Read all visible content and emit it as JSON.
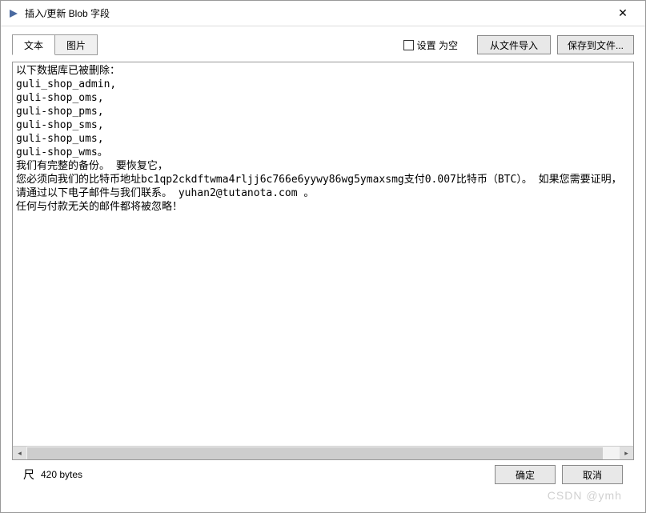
{
  "window": {
    "title": "插入/更新 Blob 字段"
  },
  "tabs": {
    "text": "文本",
    "image": "图片"
  },
  "toolbar": {
    "set_null_label": "设置 为空",
    "import_file_label": "从文件导入",
    "save_file_label": "保存到文件..."
  },
  "content": {
    "body": "以下数据库已被删除：\nguli_shop_admin,\nguli-shop_oms,\nguli-shop_pms,\nguli-shop_sms,\nguli-shop_ums,\nguli-shop_wms。\n我们有完整的备份。 要恢复它，\n您必须向我们的比特币地址bc1qp2ckdftwma4rljj6c766e6yywy86wg5ymaxsmg支付0.007比特币（BTC）。 如果您需要证明，请通过以下电子邮件与我们联系。 yuhan2@tutanota.com 。\n任何与付款无关的邮件都将被忽略！"
  },
  "status": {
    "size": "420 bytes"
  },
  "footer": {
    "ok_label": "确定",
    "cancel_label": "取消"
  },
  "watermark": "CSDN @ymh"
}
